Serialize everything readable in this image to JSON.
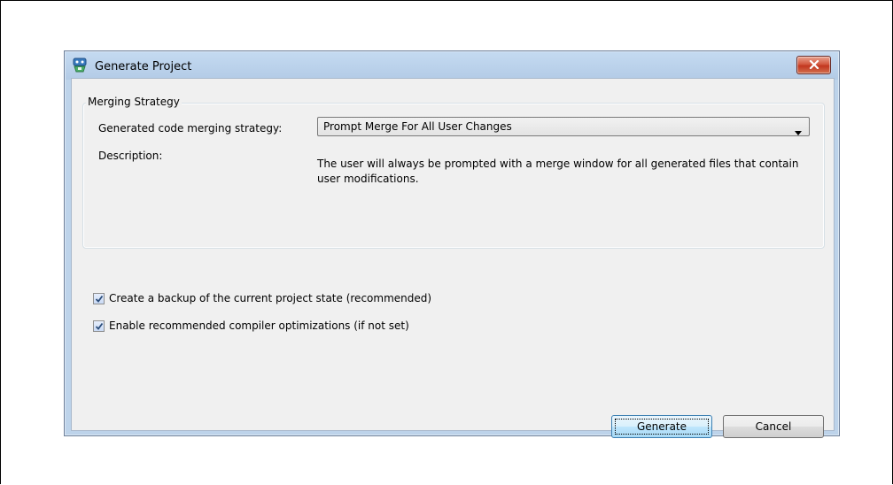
{
  "dialog": {
    "title": "Generate Project",
    "icon": "project-gear-icon",
    "close_icon": "close-icon"
  },
  "merging": {
    "group_title": "Merging Strategy",
    "strategy_label": "Generated code merging strategy:",
    "strategy_value": "Prompt Merge For All User Changes",
    "description_label": "Description:",
    "description_text": "The user will always be prompted with a merge window for all generated files that contain user modifications."
  },
  "options": [
    {
      "label": "Create a backup of the current project state (recommended)",
      "checked": true
    },
    {
      "label": "Enable recommended compiler optimizations (if not set)",
      "checked": true
    }
  ],
  "buttons": {
    "generate": "Generate",
    "cancel": "Cancel"
  },
  "colors": {
    "title_bar": "#bdd3ea",
    "client": "#f0f0f0",
    "close_button": "#c7432b",
    "primary_button": "#bee6fd"
  }
}
